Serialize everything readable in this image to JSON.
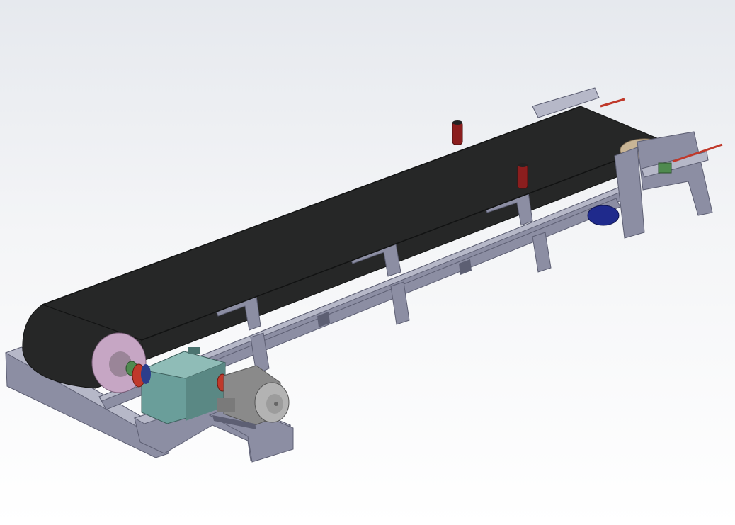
{
  "scene": {
    "view": "isometric-3d-model",
    "subject": "belt-conveyor-assembly"
  },
  "colors": {
    "background_top": "#e6e9ee",
    "background_bottom": "#ffffff",
    "belt": "#262727",
    "belt_edge": "#121313",
    "frame": "#8c8ea3",
    "frame_dark": "#5d5f73",
    "frame_light": "#b6b8c8",
    "head_pulley_face": "#c6a6c4",
    "tail_pulley_face": "#c9b596",
    "gearbox": "#6a9e9a",
    "gearbox_light": "#8fbcb7",
    "motor": "#8a8a8a",
    "motor_light": "#b3b3b3",
    "idler": "#1f2a8c",
    "side_roller": "#8b1e1e",
    "coupling_red": "#c0392b",
    "bearing_green": "#4f8a4f",
    "tension_rod": "#c0392b"
  }
}
